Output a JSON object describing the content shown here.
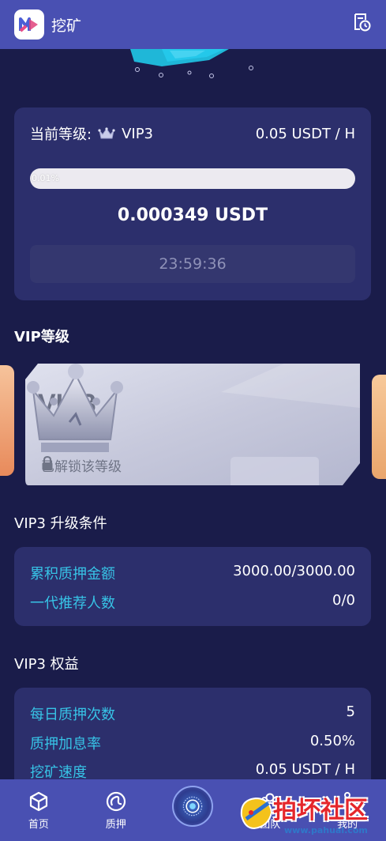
{
  "header": {
    "title": "挖矿",
    "logo_icon": "app-logo-icon",
    "history_icon": "history-clock-icon"
  },
  "mining": {
    "level_label": "当前等级:",
    "level_value": "VIP3",
    "rate": "0.05 USDT / H",
    "progress_text": "0.01%",
    "progress_fraction": 0.0001,
    "mined_amount": "0.000349 USDT",
    "countdown": "23:59:36"
  },
  "vip_section": {
    "title": "VIP等级",
    "card_name": "VIP3",
    "status": "已解锁该等级"
  },
  "conditions": {
    "title": "VIP3 升级条件",
    "rows": [
      {
        "label": "累积质押金额",
        "value": "3000.00/3000.00"
      },
      {
        "label": "一代推荐人数",
        "value": "0/0"
      }
    ]
  },
  "rights": {
    "title": "VIP3 权益",
    "rows": [
      {
        "label": "每日质押次数",
        "value": "5"
      },
      {
        "label": "质押加息率",
        "value": "0.50%"
      },
      {
        "label": "挖矿速度",
        "value": "0.05 USDT / H"
      }
    ]
  },
  "tabbar": {
    "items": [
      {
        "label": "首页",
        "icon": "cube-icon"
      },
      {
        "label": "质押",
        "icon": "coin-icon"
      },
      {
        "label": "",
        "icon": "mining-center-icon"
      },
      {
        "label": "团队",
        "icon": "team-icon"
      },
      {
        "label": "我的",
        "icon": "user-icon"
      }
    ]
  },
  "watermark": {
    "text": "拍坏社区",
    "url": "www.pahuai.com"
  },
  "colors": {
    "background": "#1a1c4a",
    "header": "#4950b2",
    "card": "#2c2f6c",
    "accent_label": "#37c3e6"
  }
}
